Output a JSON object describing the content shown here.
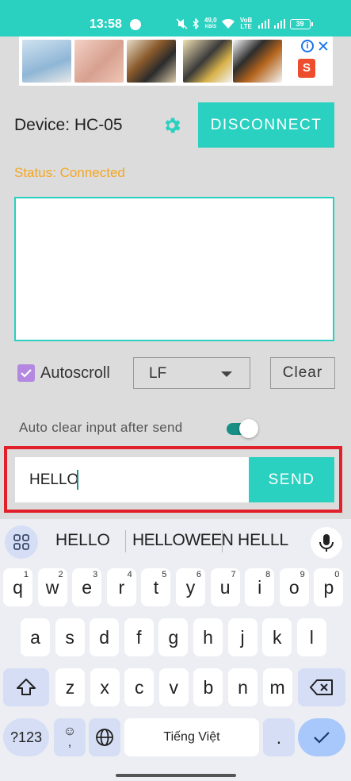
{
  "status_bar": {
    "time": "13:58",
    "speed_value": "49,0",
    "speed_unit": "KB/S",
    "network": "VoB LTE",
    "battery": "39"
  },
  "ad": {
    "info_glyph": "i",
    "close_glyph": "✕",
    "shop_glyph": "S"
  },
  "device": {
    "label": "Device: HC-05",
    "disconnect_label": "DISCONNECT"
  },
  "status": {
    "text": "Status: Connected"
  },
  "output": {
    "text": ""
  },
  "controls": {
    "autoscroll_label": "Autoscroll",
    "autoscroll_checked": true,
    "line_ending": "LF",
    "clear_label": "Clear",
    "auto_clear_label": "Auto clear input after send",
    "auto_clear_on": true
  },
  "send": {
    "input_value": "HELLO",
    "button_label": "SEND"
  },
  "keyboard": {
    "suggestions": [
      "HELLO",
      "HELLOWEEN",
      "HELLL"
    ],
    "row1": [
      {
        "k": "q",
        "h": "1"
      },
      {
        "k": "w",
        "h": "2"
      },
      {
        "k": "e",
        "h": "3"
      },
      {
        "k": "r",
        "h": "4"
      },
      {
        "k": "t",
        "h": "5"
      },
      {
        "k": "y",
        "h": "6"
      },
      {
        "k": "u",
        "h": "7"
      },
      {
        "k": "i",
        "h": "8"
      },
      {
        "k": "o",
        "h": "9"
      },
      {
        "k": "p",
        "h": "0"
      }
    ],
    "row2": [
      "a",
      "s",
      "d",
      "f",
      "g",
      "h",
      "j",
      "k",
      "l"
    ],
    "row3": [
      "z",
      "x",
      "c",
      "v",
      "b",
      "n",
      "m"
    ],
    "symbols_label": "?123",
    "emoji_glyph": "☺",
    "comma": ",",
    "space_label": "Tiếng Việt",
    "period": "."
  },
  "colors": {
    "accent": "#2ad1c0",
    "status_connected": "#f5a623",
    "highlight_frame": "#e0202a"
  }
}
